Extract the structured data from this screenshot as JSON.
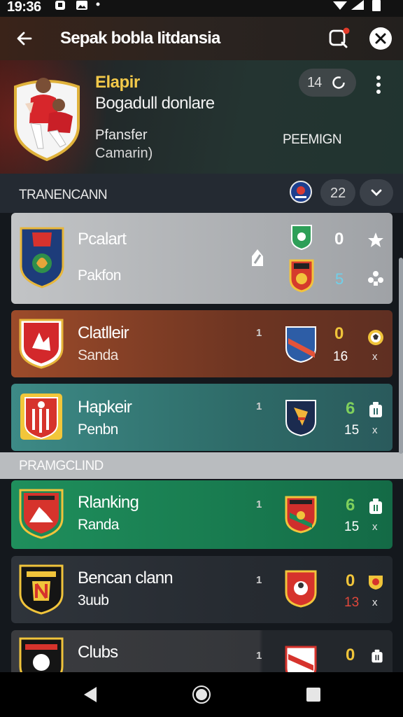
{
  "status_bar": {
    "time": "19:36"
  },
  "app_bar": {
    "title": "Sepak bobla Iitdansia"
  },
  "player": {
    "name": "Elapir",
    "subtitle": "Bogadull donlare",
    "role": "Pfansfer",
    "team": "Camarin)",
    "league": "PEEMIGN",
    "count": "14"
  },
  "section1": {
    "title": "TRANENCANN",
    "count": "22"
  },
  "section2": {
    "title": "PRAMGCLIND"
  },
  "matches": [
    {
      "team1": "Pcalart",
      "team2": "Pakfon",
      "dot": "",
      "score1": "0",
      "score2": "5",
      "extra": "",
      "score2_color": "#6fd0ea"
    },
    {
      "team1": "Clatlleir",
      "team2": "Sanda",
      "dot": "1",
      "score1": "0",
      "score2": "16",
      "extra": "x",
      "score2_color": "#e6e6e6"
    },
    {
      "team1": "Hapkeir",
      "team2": "Penbn",
      "dot": "1",
      "score1": "6",
      "score2": "15",
      "extra": "x",
      "score2_color": "#e6e6e6"
    },
    {
      "team1": "Rlanking",
      "team2": "Randa",
      "dot": "1",
      "score1": "6",
      "score2": "15",
      "extra": "x",
      "score2_color": "#e6e6e6"
    },
    {
      "team1": "Bencan clann",
      "team2": "3uub",
      "dot": "1",
      "score1": "0",
      "score2": "13",
      "extra": "x",
      "score2_color": "#e0473b"
    },
    {
      "team1": "Clubs",
      "team2": "",
      "dot": "1",
      "score1": "0",
      "score2": "",
      "extra": "",
      "score2_color": "#e6e6e6"
    }
  ],
  "colors": {
    "score_gold": "#f0c43a",
    "score_green": "#7fd05c",
    "accent_red": "#e23b2a"
  }
}
